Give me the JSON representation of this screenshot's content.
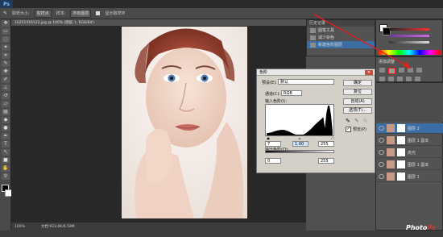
{
  "app": {
    "logo": "Ps"
  },
  "document": {
    "tab_title": "16251416122.jpg @ 100% (图层 1, RGB/8#)",
    "status_zoom": "100%",
    "status_doc": "文档:933.6K/6.59M"
  },
  "options_bar": {
    "size_label": "取样大小:",
    "size_value": "取样点",
    "sample_label": "样本:",
    "sample_value": "所有图层",
    "ring_label": "显示取样环"
  },
  "history": {
    "title": "历史记录",
    "items": [
      {
        "label": "圆笔工具"
      },
      {
        "label": "减少杂色"
      },
      {
        "label": "新建色阶图层"
      }
    ]
  },
  "adjustments": {
    "title": "添加调整"
  },
  "layers": {
    "items": [
      {
        "label": "图层 2",
        "active": true
      },
      {
        "label": "图层 1 副本",
        "active": false
      },
      {
        "label": "高光",
        "active": false
      },
      {
        "label": "图层 1 副本",
        "active": false
      },
      {
        "label": "图层 1",
        "active": false
      }
    ]
  },
  "levels_dialog": {
    "title": "色阶",
    "preset_label": "预设(E):",
    "preset_value": "默认",
    "channel_label": "通道(C):",
    "channel_value": "RGB",
    "input_label": "输入色阶(I):",
    "input_black": "7",
    "input_gamma": "1.00",
    "input_white": "255",
    "output_label": "输出色阶(O):",
    "output_black": "0",
    "output_white": "255",
    "btn_ok": "确定",
    "btn_reset": "复位",
    "btn_auto": "自动(A)",
    "btn_options": "选项(T)...",
    "preview_label": "预览(P)",
    "preview_checked": true
  },
  "watermark": {
    "text1": "Photo",
    "text2": "Ps"
  },
  "colors": {
    "accent": "#3b6ea5",
    "arrow": "#e0201c"
  }
}
